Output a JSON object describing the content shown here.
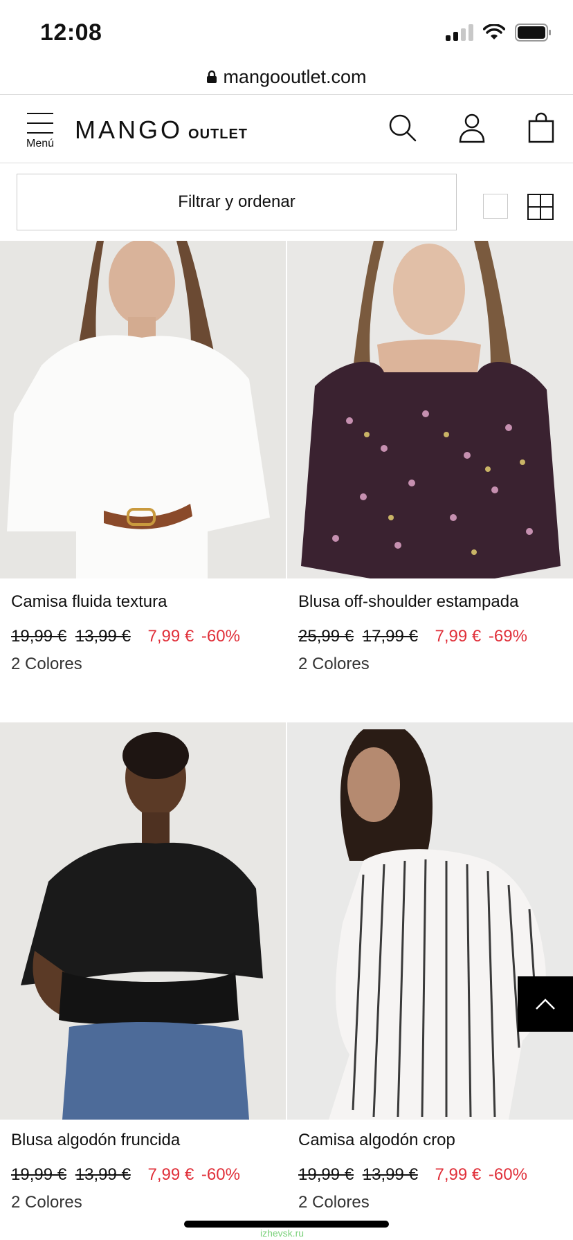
{
  "status_bar": {
    "time": "12:08"
  },
  "browser": {
    "url": "mangooutlet.com"
  },
  "header": {
    "menu_label": "Menú",
    "logo_main": "MANGO",
    "logo_sub": "OUTLET"
  },
  "filter": {
    "label": "Filtrar y ordenar"
  },
  "products": [
    {
      "name": "Camisa fluida textura",
      "old_price_1": "19,99 €",
      "old_price_2": "13,99 €",
      "price": "7,99 €",
      "discount": "-60%",
      "colors": "2 Colores"
    },
    {
      "name": "Blusa off-shoulder estampada",
      "old_price_1": "25,99 €",
      "old_price_2": "17,99 €",
      "price": "7,99 €",
      "discount": "-69%",
      "colors": "2 Colores"
    },
    {
      "name": "Blusa algodón fruncida",
      "old_price_1": "19,99 €",
      "old_price_2": "13,99 €",
      "price": "7,99 €",
      "discount": "-60%",
      "colors": "2 Colores"
    },
    {
      "name": "Camisa algodón crop",
      "old_price_1": "19,99 €",
      "old_price_2": "13,99 €",
      "price": "7,99 €",
      "discount": "-60%",
      "colors": "2 Colores"
    }
  ],
  "watermark": "izhevsk.ru",
  "colors": {
    "sale": "#e0303a",
    "text": "#111111",
    "border": "#c9c9c9"
  }
}
